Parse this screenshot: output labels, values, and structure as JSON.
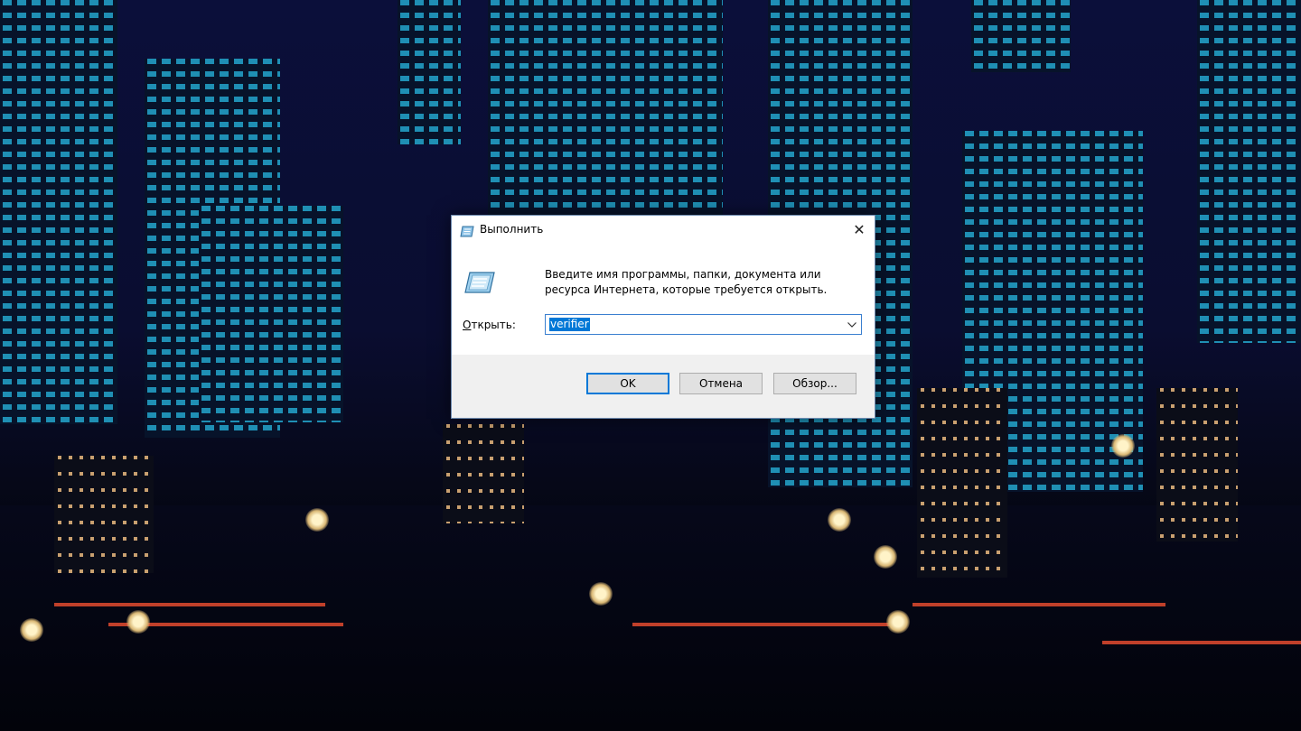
{
  "dialog": {
    "title": "Выполнить",
    "close_glyph": "✕",
    "message": "Введите имя программы, папки, документа или ресурса Интернета, которые требуется открыть.",
    "open_label_accel": "О",
    "open_label_rest": "ткрыть:",
    "input_value": "verifier",
    "buttons": {
      "ok": "OK",
      "cancel": "Отмена",
      "browse": "Обзор..."
    },
    "icons": {
      "title": "run-icon",
      "body": "run-icon",
      "dropdown": "chevron-down-icon",
      "close": "close-icon"
    },
    "colors": {
      "accent": "#0078d7",
      "button_bar": "#f0f0f0"
    }
  }
}
